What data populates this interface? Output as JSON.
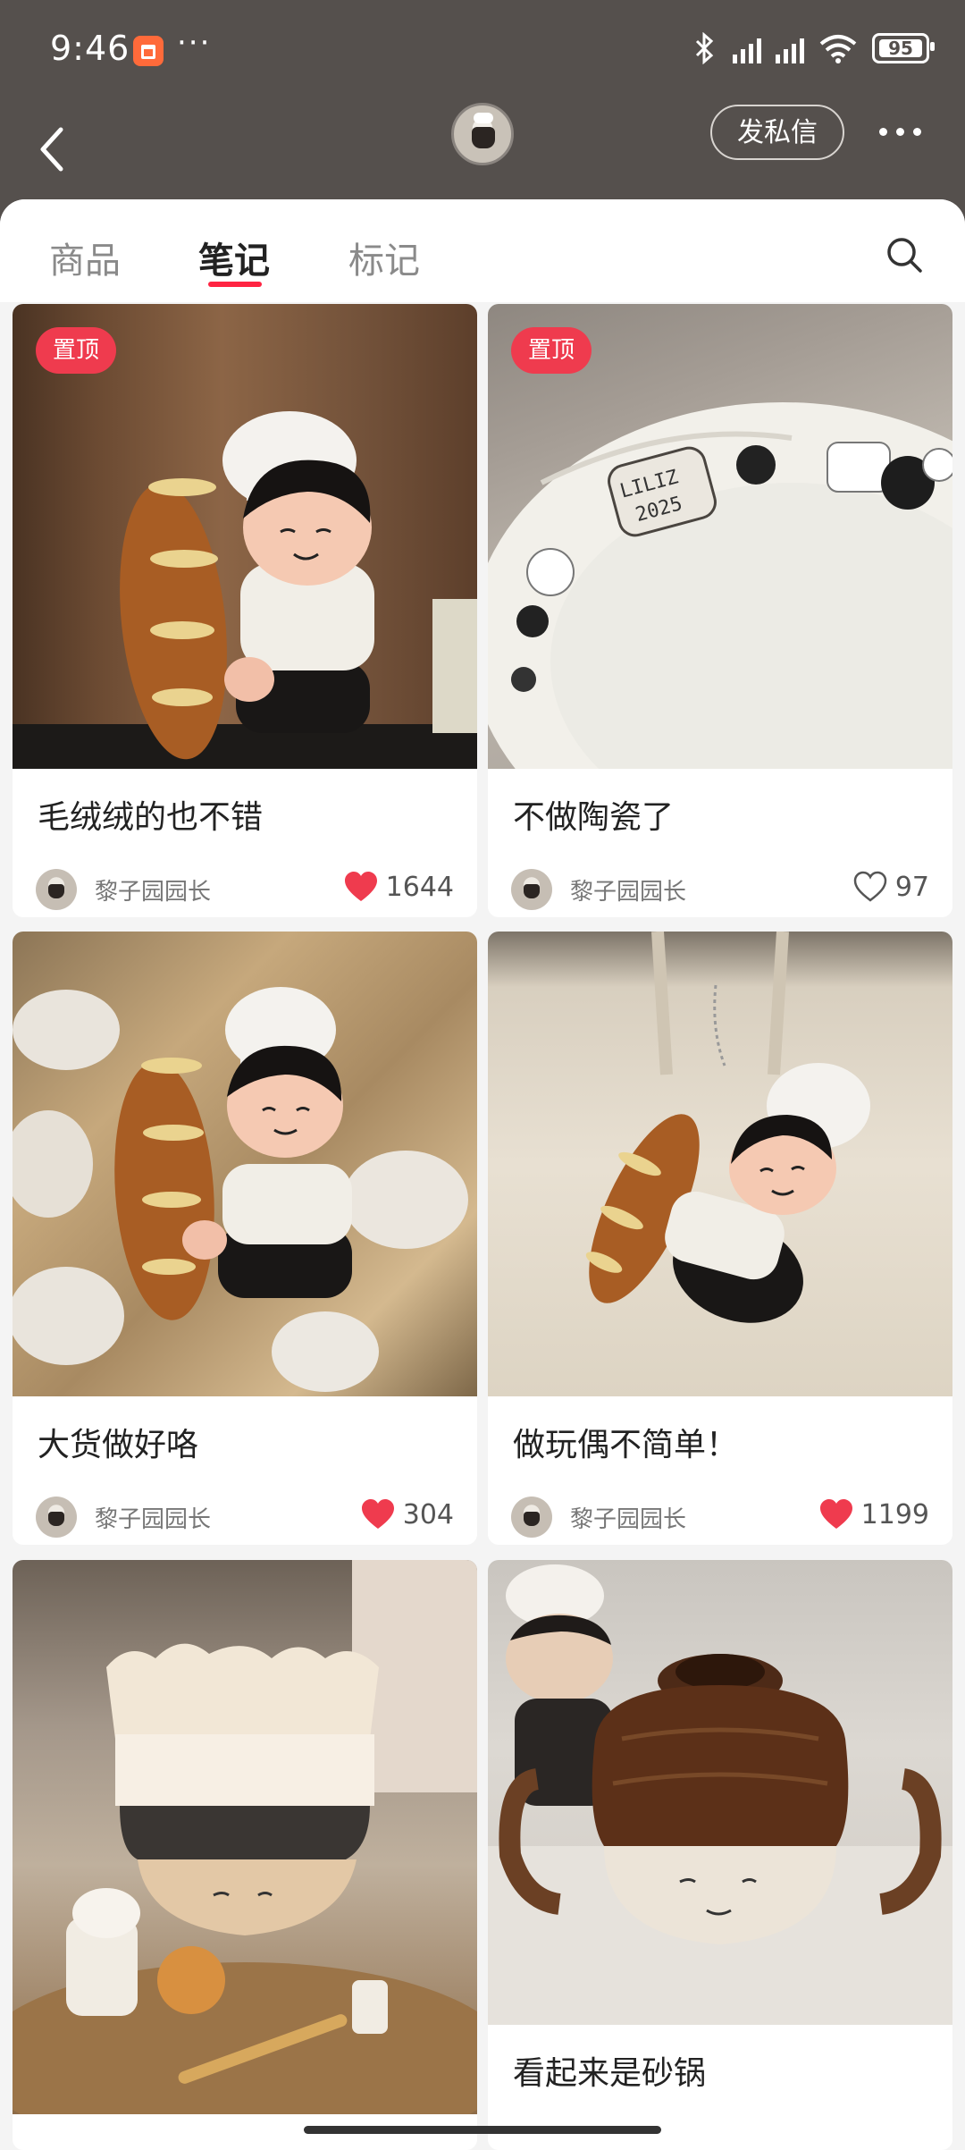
{
  "status": {
    "time": "9:46",
    "battery": "95"
  },
  "header": {
    "dm_label": "发私信"
  },
  "tabs": {
    "items": [
      "商品",
      "笔记",
      "标记"
    ],
    "active": 1
  },
  "colors": {
    "accent": "#ff2442",
    "pin": "#ef3b4e",
    "topbar": "#55504d"
  },
  "notes": [
    {
      "title": "毛绒绒的也不错",
      "pinned_label": "置顶",
      "author": "黎子园园长",
      "likes": "1644",
      "liked": true
    },
    {
      "title": "不做陶瓷了",
      "pinned_label": "置顶",
      "author": "黎子园园长",
      "likes": "97",
      "liked": false
    },
    {
      "title": "大货做好咯",
      "author": "黎子园园长",
      "likes": "304",
      "liked": true
    },
    {
      "title": "做玩偶不简单！",
      "author": "黎子园园长",
      "likes": "1199",
      "liked": true
    },
    {
      "title": ""
    },
    {
      "title": "看起来是砂锅"
    }
  ],
  "plate_text": [
    "LILIZ",
    "2025"
  ]
}
